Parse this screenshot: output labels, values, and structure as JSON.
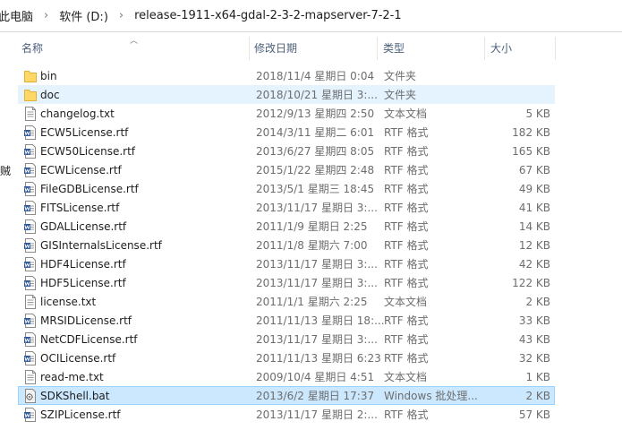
{
  "address": {
    "crumbs": [
      "此电脑",
      "软件 (D:)",
      "release-1911-x64-gdal-2-3-2-mapserver-7-2-1"
    ]
  },
  "header": {
    "name": "名称",
    "date": "修改日期",
    "type": "类型",
    "size": "大小"
  },
  "left_pane_fragment": "贼",
  "files": [
    {
      "name": "bin",
      "date": "2018/11/4 星期日 0:04",
      "type": "文件夹",
      "size": "",
      "icon": "folder-icon",
      "state": ""
    },
    {
      "name": "doc",
      "date": "2018/10/21 星期日 3:...",
      "type": "文件夹",
      "size": "",
      "icon": "folder-icon",
      "state": "hover"
    },
    {
      "name": "changelog.txt",
      "date": "2012/9/13 星期四 2:50",
      "type": "文本文档",
      "size": "5 KB",
      "icon": "text-file-icon",
      "state": ""
    },
    {
      "name": "ECW5License.rtf",
      "date": "2014/3/11 星期二 6:01",
      "type": "RTF 格式",
      "size": "182 KB",
      "icon": "rtf-file-icon",
      "state": ""
    },
    {
      "name": "ECW50License.rtf",
      "date": "2013/6/27 星期四 8:05",
      "type": "RTF 格式",
      "size": "165 KB",
      "icon": "rtf-file-icon",
      "state": ""
    },
    {
      "name": "ECWLicense.rtf",
      "date": "2015/1/22 星期四 2:48",
      "type": "RTF 格式",
      "size": "67 KB",
      "icon": "rtf-file-icon",
      "state": ""
    },
    {
      "name": "FileGDBLicense.rtf",
      "date": "2013/5/1 星期三 18:45",
      "type": "RTF 格式",
      "size": "49 KB",
      "icon": "rtf-file-icon",
      "state": ""
    },
    {
      "name": "FITSLicense.rtf",
      "date": "2013/11/17 星期日 3:...",
      "type": "RTF 格式",
      "size": "41 KB",
      "icon": "rtf-file-icon",
      "state": ""
    },
    {
      "name": "GDALLicense.rtf",
      "date": "2011/1/9 星期日 2:25",
      "type": "RTF 格式",
      "size": "14 KB",
      "icon": "rtf-file-icon",
      "state": ""
    },
    {
      "name": "GISInternalsLicense.rtf",
      "date": "2011/1/8 星期六 7:00",
      "type": "RTF 格式",
      "size": "12 KB",
      "icon": "rtf-file-icon",
      "state": ""
    },
    {
      "name": "HDF4License.rtf",
      "date": "2013/11/17 星期日 3:...",
      "type": "RTF 格式",
      "size": "42 KB",
      "icon": "rtf-file-icon",
      "state": ""
    },
    {
      "name": "HDF5License.rtf",
      "date": "2013/11/17 星期日 3:...",
      "type": "RTF 格式",
      "size": "122 KB",
      "icon": "rtf-file-icon",
      "state": ""
    },
    {
      "name": "license.txt",
      "date": "2011/1/1 星期六 2:25",
      "type": "文本文档",
      "size": "2 KB",
      "icon": "text-file-icon",
      "state": ""
    },
    {
      "name": "MRSIDLicense.rtf",
      "date": "2011/11/13 星期日 18:...",
      "type": "RTF 格式",
      "size": "33 KB",
      "icon": "rtf-file-icon",
      "state": ""
    },
    {
      "name": "NetCDFLicense.rtf",
      "date": "2013/11/17 星期日 3:...",
      "type": "RTF 格式",
      "size": "43 KB",
      "icon": "rtf-file-icon",
      "state": ""
    },
    {
      "name": "OCILicense.rtf",
      "date": "2011/11/13 星期日 6:23",
      "type": "RTF 格式",
      "size": "32 KB",
      "icon": "rtf-file-icon",
      "state": ""
    },
    {
      "name": "read-me.txt",
      "date": "2009/10/4 星期日 4:51",
      "type": "文本文档",
      "size": "1 KB",
      "icon": "text-file-icon",
      "state": ""
    },
    {
      "name": "SDKShell.bat",
      "date": "2013/6/2 星期日 17:37",
      "type": "Windows 批处理...",
      "size": "2 KB",
      "icon": "batch-file-icon",
      "state": "sel"
    },
    {
      "name": "SZIPLicense.rtf",
      "date": "2013/11/17 星期日 2:...",
      "type": "RTF 格式",
      "size": "57 KB",
      "icon": "rtf-file-icon",
      "state": ""
    }
  ],
  "colors": {
    "hover": "#e5f3ff",
    "selected": "#cce8ff",
    "selected_border": "#99d1ff",
    "folder": "#ffd766",
    "header_text": "#4c607a"
  }
}
